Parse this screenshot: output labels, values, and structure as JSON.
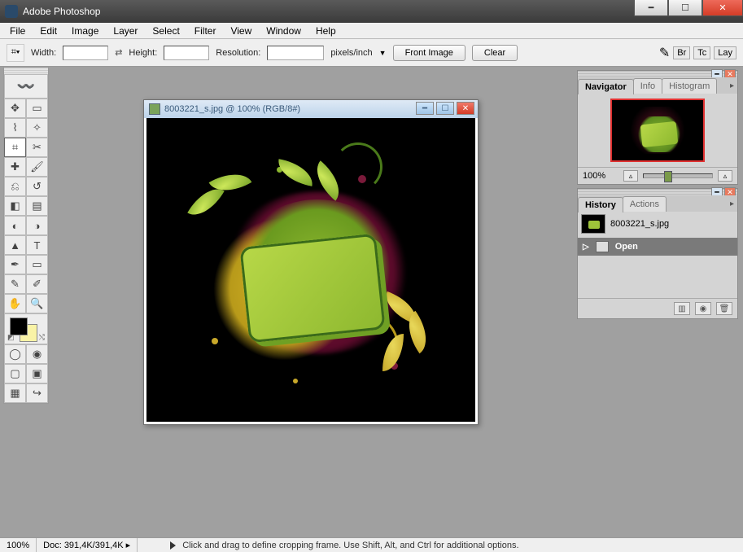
{
  "titlebar": {
    "app_name": "Adobe Photoshop"
  },
  "menu": {
    "items": [
      "File",
      "Edit",
      "Image",
      "Layer",
      "Select",
      "Filter",
      "View",
      "Window",
      "Help"
    ]
  },
  "options": {
    "width_label": "Width:",
    "height_label": "Height:",
    "resolution_label": "Resolution:",
    "units": "pixels/inch",
    "front_image": "Front Image",
    "clear": "Clear",
    "right_tabs": [
      "Br",
      "Tc",
      "Lay"
    ]
  },
  "toolbox": {
    "tools": [
      [
        "move-tool",
        "✥"
      ],
      [
        "rect-marquee-tool",
        "▭"
      ],
      [
        "lasso-tool",
        "⌇"
      ],
      [
        "magic-wand-tool",
        "✧"
      ],
      [
        "crop-tool",
        "⌗"
      ],
      [
        "slice-tool",
        "✂"
      ],
      [
        "healing-brush-tool",
        "✚"
      ],
      [
        "brush-tool",
        "🖌"
      ],
      [
        "clone-stamp-tool",
        "⎌"
      ],
      [
        "history-brush-tool",
        "↺"
      ],
      [
        "eraser-tool",
        "◧"
      ],
      [
        "gradient-tool",
        "▤"
      ],
      [
        "blur-tool",
        "◐"
      ],
      [
        "dodge-tool",
        "◑"
      ],
      [
        "path-select-tool",
        "▲"
      ],
      [
        "type-tool",
        "T"
      ],
      [
        "pen-tool",
        "✒"
      ],
      [
        "shape-tool",
        "▭"
      ],
      [
        "notes-tool",
        "✎"
      ],
      [
        "eyedropper-tool",
        "✐"
      ],
      [
        "hand-tool",
        "✋"
      ],
      [
        "zoom-tool",
        "🔍"
      ]
    ],
    "mode_standard": "◯",
    "mode_quickmask": "◉",
    "screen_modes": [
      "▢",
      "▣",
      "▦"
    ],
    "jump": "↪"
  },
  "document": {
    "title": "8003221_s.jpg @ 100% (RGB/8#)"
  },
  "navigator": {
    "tabs": [
      "Navigator",
      "Info",
      "Histogram"
    ],
    "zoom": "100%"
  },
  "history": {
    "tabs": [
      "History",
      "Actions"
    ],
    "source_name": "8003221_s.jpg",
    "step": "Open"
  },
  "status": {
    "zoom": "100%",
    "doc": "Doc: 391,4K/391,4K",
    "hint": "Click and drag to define cropping frame. Use Shift, Alt, and Ctrl for additional options."
  }
}
